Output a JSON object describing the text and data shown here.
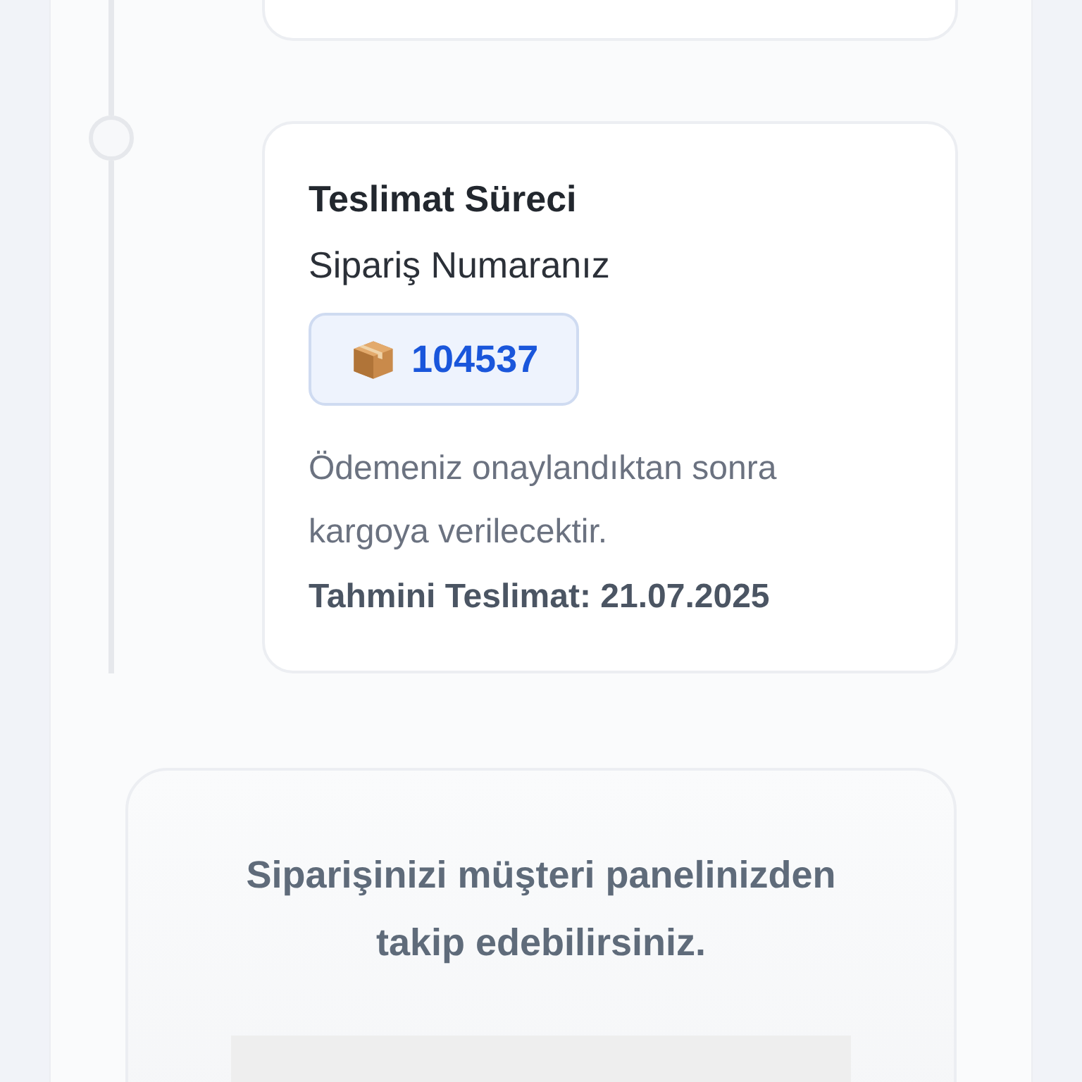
{
  "timeline": [
    {
      "title": "Teslimat Süreci",
      "subtitle": "Sipariş Numaranız",
      "order_number": "104537",
      "description": "Ödemeniz onaylandıktan sonra kargoya verilecektir.",
      "estimated_delivery": "Tahmini Teslimat: 21.07.2025"
    }
  ],
  "info": {
    "text": "Siparişinizi müşteri panelinizden takip edebilirsiniz."
  }
}
